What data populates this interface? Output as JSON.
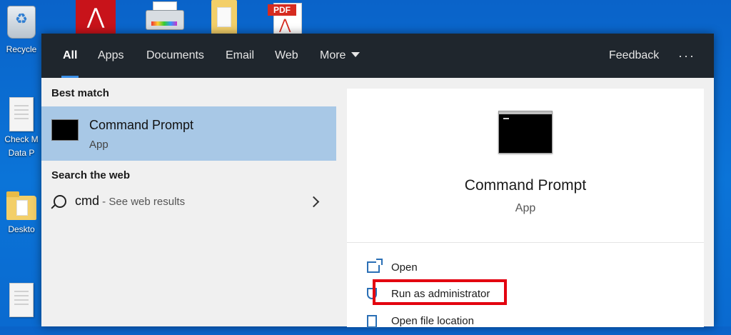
{
  "desktop": {
    "icons": [
      {
        "label": "Recycle",
        "icon": "recycle-bin-icon"
      },
      {
        "label": "Check M\nData P",
        "icon": "document-icon"
      },
      {
        "label": "Deskto",
        "icon": "folder-icon"
      },
      {
        "label": "",
        "icon": "document-icon"
      }
    ],
    "top_icons": [
      "acrobat-icon",
      "printer-icon",
      "folder-icon",
      "pdf-file-icon"
    ],
    "pdf_tag": "PDF"
  },
  "search": {
    "tabs": [
      "All",
      "Apps",
      "Documents",
      "Email",
      "Web",
      "More"
    ],
    "active_tab": "All",
    "feedback_label": "Feedback",
    "overflow_label": "···",
    "best_match_heading": "Best match",
    "best_match": {
      "title": "Command Prompt",
      "subtitle": "App"
    },
    "web_heading": "Search the web",
    "web_query": "cmd",
    "web_suffix": " - See web results",
    "detail": {
      "title": "Command Prompt",
      "subtitle": "App"
    },
    "actions": [
      "Open",
      "Run as administrator",
      "Open file location"
    ],
    "highlighted_action": "Run as administrator",
    "colors": {
      "highlight": "#e3000f",
      "selected_row": "#a8c8e6",
      "nav_bg": "#1f262d",
      "accent": "#3a8ee6"
    }
  }
}
